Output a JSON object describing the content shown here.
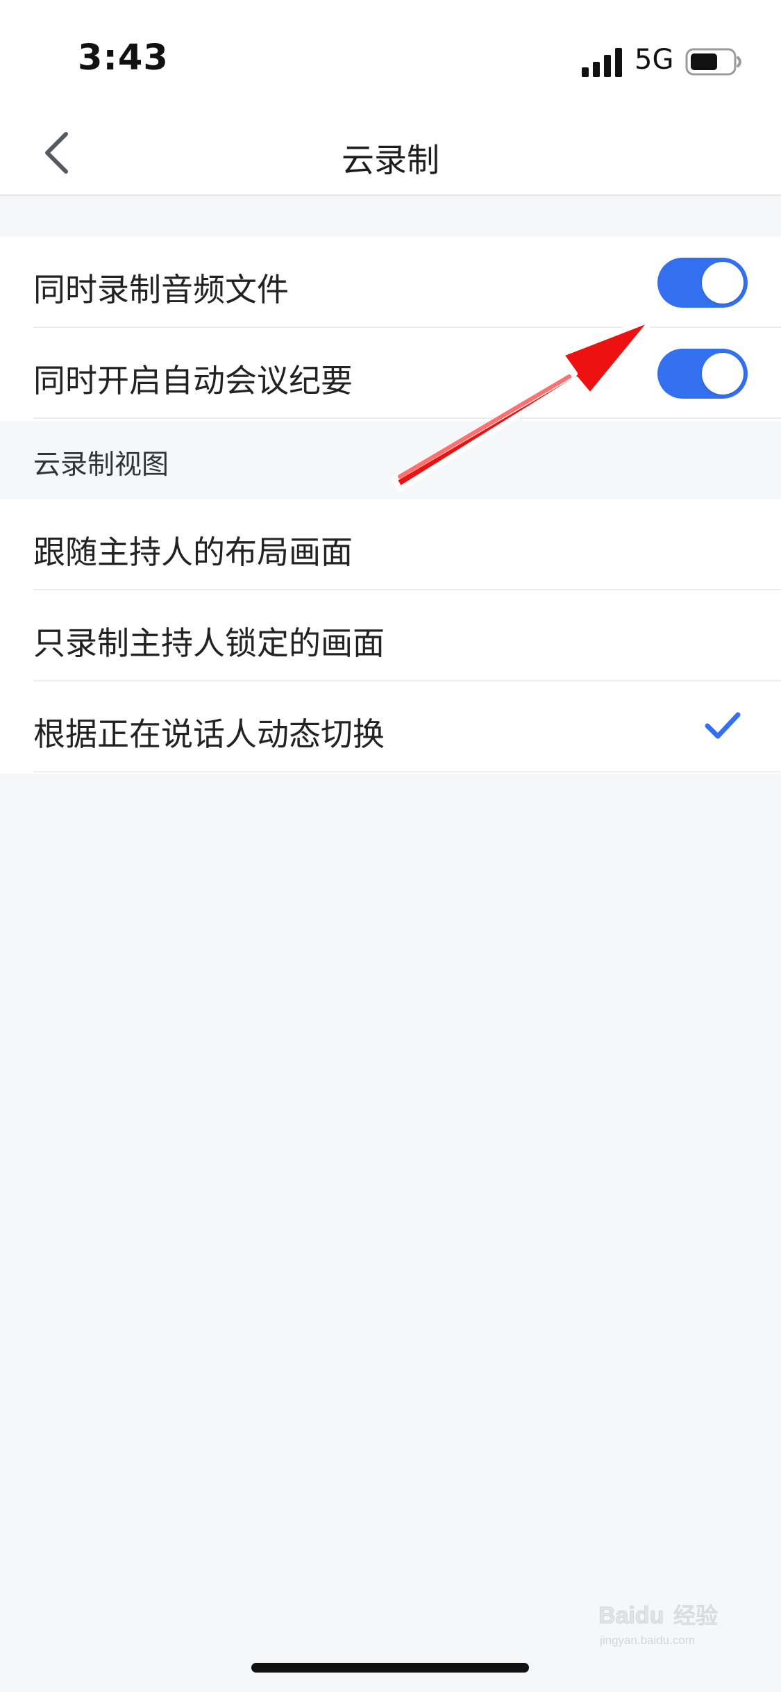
{
  "status_bar": {
    "time": "3:43",
    "network": "5G",
    "signal_bars": 4,
    "battery_level": 0.65
  },
  "nav": {
    "title": "云录制",
    "back_icon": "chevron-left-icon"
  },
  "toggles": [
    {
      "label": "同时录制音频文件",
      "on": true
    },
    {
      "label": "同时开启自动会议纪要",
      "on": true
    }
  ],
  "view_section": {
    "header": "云录制视图",
    "options": [
      {
        "label": "跟随主持人的布局画面",
        "selected": false
      },
      {
        "label": "只录制主持人锁定的画面",
        "selected": false
      },
      {
        "label": "根据正在说话人动态切换",
        "selected": true
      }
    ]
  },
  "colors": {
    "accent": "#3370f0",
    "background": "#f6f7f9",
    "annotation": "#ee1111"
  },
  "watermark": {
    "brand": "Baidu",
    "text": "经验",
    "url": "jingyan.baidu.com"
  }
}
